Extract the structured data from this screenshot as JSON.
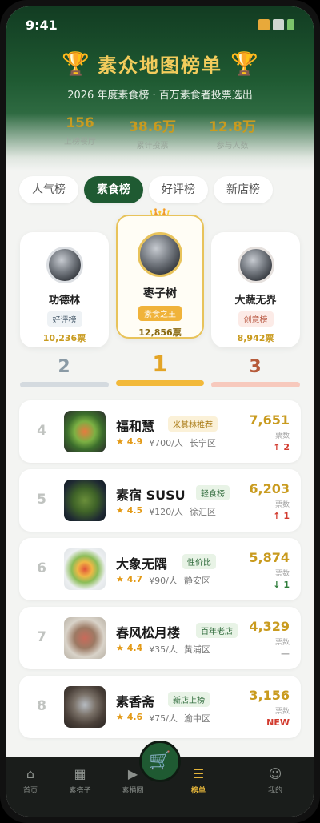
{
  "status": {
    "time": "9:41"
  },
  "header": {
    "title": "素众地图榜单",
    "subtitle": "2026 年度素食榜 · 百万素食者投票选出",
    "stats": [
      {
        "value": "156",
        "label": "上榜餐厅"
      },
      {
        "value": "38.6万",
        "label": "累计投票"
      },
      {
        "value": "12.8万",
        "label": "参与人数"
      }
    ]
  },
  "tabs": [
    {
      "label": "人气榜",
      "active": false
    },
    {
      "label": "素食榜",
      "active": true
    },
    {
      "label": "好评榜",
      "active": false
    },
    {
      "label": "新店榜",
      "active": false
    }
  ],
  "podium": [
    {
      "rank": "2",
      "name": "功德林",
      "badge": "好评榜",
      "votes": "10,236票"
    },
    {
      "rank": "1",
      "name": "枣子树",
      "badge": "素食之王",
      "votes": "12,856票"
    },
    {
      "rank": "3",
      "name": "大蔬无界",
      "badge": "创意榜",
      "votes": "8,942票"
    }
  ],
  "list": [
    {
      "rank": "4",
      "name": "福和慧",
      "tag": "米其林推荐",
      "rating": "★ 4.9",
      "price": "¥700/人",
      "district": "长宁区",
      "votes": "7,651",
      "votes_label": "票数",
      "trend": "↑ 2"
    },
    {
      "rank": "5",
      "name": "素宿 SUSU",
      "tag": "轻食榜",
      "rating": "★ 4.5",
      "price": "¥120/人",
      "district": "徐汇区",
      "votes": "6,203",
      "votes_label": "票数",
      "trend": "↑ 1"
    },
    {
      "rank": "6",
      "name": "大象无隅",
      "tag": "性价比",
      "rating": "★ 4.7",
      "price": "¥90/人",
      "district": "静安区",
      "votes": "5,874",
      "votes_label": "票数",
      "trend": "↓ 1"
    },
    {
      "rank": "7",
      "name": "春风松月楼",
      "tag": "百年老店",
      "rating": "★ 4.4",
      "price": "¥35/人",
      "district": "黄浦区",
      "votes": "4,329",
      "votes_label": "票数",
      "trend": "—"
    },
    {
      "rank": "8",
      "name": "素香斋",
      "tag": "新店上榜",
      "rating": "★ 4.6",
      "price": "¥75/人",
      "district": "渝中区",
      "votes": "3,156",
      "votes_label": "票数",
      "trend": "NEW"
    }
  ],
  "nav": [
    {
      "label": "首页",
      "icon": "home-icon",
      "active": false
    },
    {
      "label": "素搭子",
      "icon": "grid-icon",
      "active": false
    },
    {
      "label": "素播圈",
      "icon": "video-icon",
      "active": false
    },
    {
      "label": "榜单",
      "icon": "list-icon",
      "active": true
    },
    {
      "label": "我的",
      "icon": "user-icon",
      "active": false
    }
  ],
  "colors": {
    "primary": "#1f5a32",
    "gold": "#c99b1f",
    "up": "#d23b2f",
    "down": "#2e7d3a"
  }
}
